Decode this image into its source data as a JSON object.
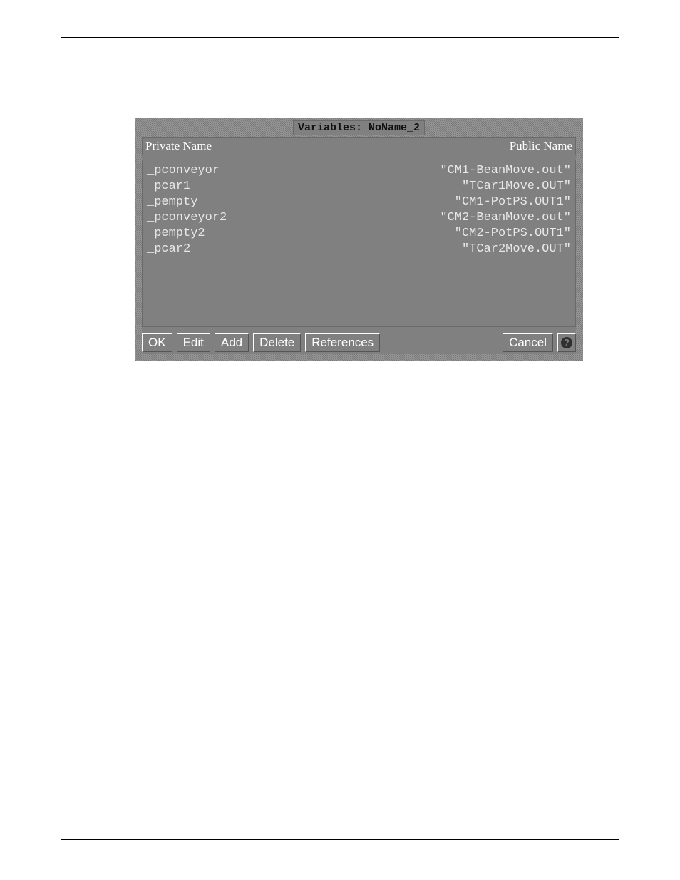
{
  "dialog": {
    "title": "Variables: NoName_2",
    "headers": {
      "private": "Private Name",
      "public": "Public Name"
    },
    "rows": [
      {
        "private": "_pconveyor",
        "public": "\"CM1-BeanMove.out\""
      },
      {
        "private": "_pcar1",
        "public": "\"TCar1Move.OUT\""
      },
      {
        "private": "_pempty",
        "public": "\"CM1-PotPS.OUT1\""
      },
      {
        "private": "_pconveyor2",
        "public": "\"CM2-BeanMove.out\""
      },
      {
        "private": "_pempty2",
        "public": "\"CM2-PotPS.OUT1\""
      },
      {
        "private": "_pcar2",
        "public": "\"TCar2Move.OUT\""
      }
    ],
    "buttons": {
      "ok": "OK",
      "edit": "Edit",
      "add": "Add",
      "delete": "Delete",
      "references": "References",
      "cancel": "Cancel",
      "help_icon": "?"
    }
  }
}
